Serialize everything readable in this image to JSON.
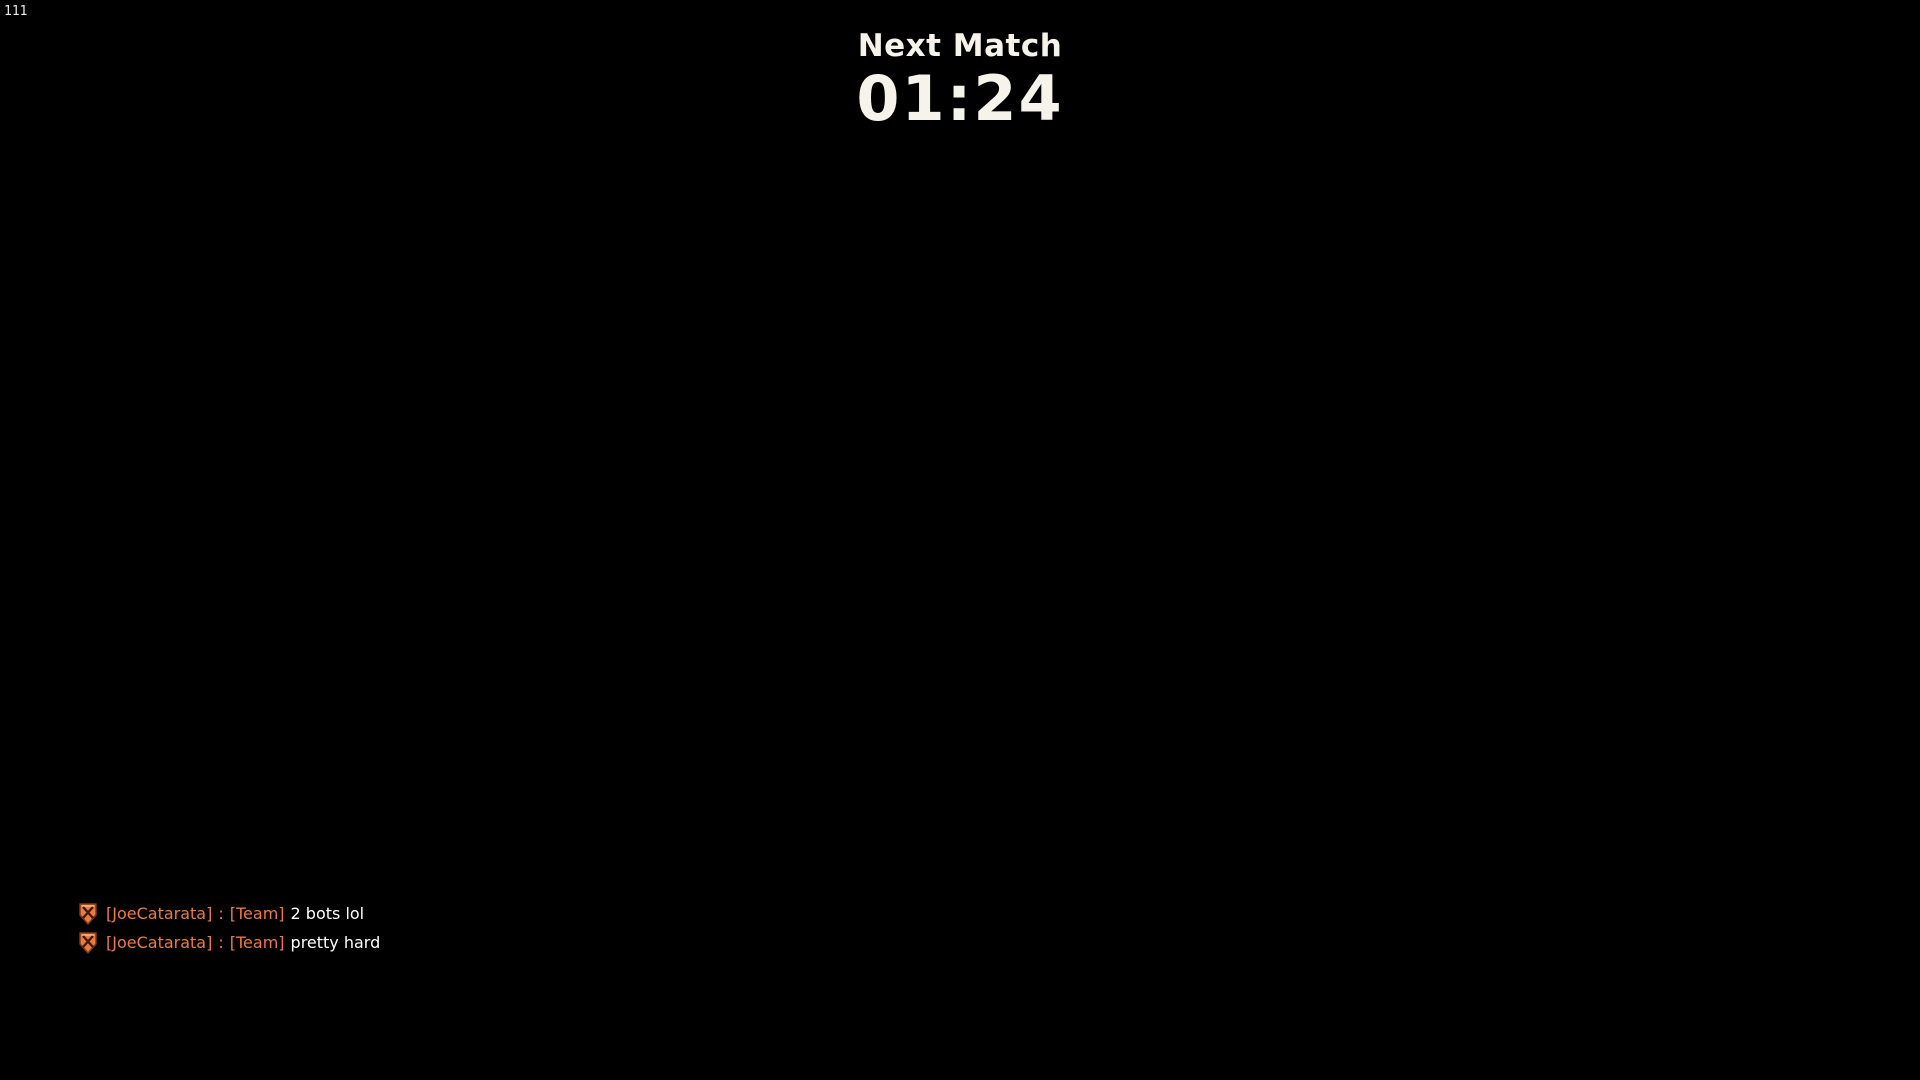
{
  "fps": "111",
  "timer": {
    "title": "Next Match",
    "value": "01:24"
  },
  "chat": {
    "messages": [
      {
        "icon": "team-shield-icon",
        "sender": "[JoeCatarata]",
        "separator": ":",
        "channel": "[Team]",
        "text": "2 bots lol"
      },
      {
        "icon": "team-shield-icon",
        "sender": "[JoeCatarata]",
        "separator": ":",
        "channel": "[Team]",
        "text": "pretty hard"
      }
    ]
  },
  "colors": {
    "background": "#000000",
    "team_orange": "#f07a3c",
    "timer_text": "#f6f4ea",
    "message_text": "#ffffff"
  }
}
